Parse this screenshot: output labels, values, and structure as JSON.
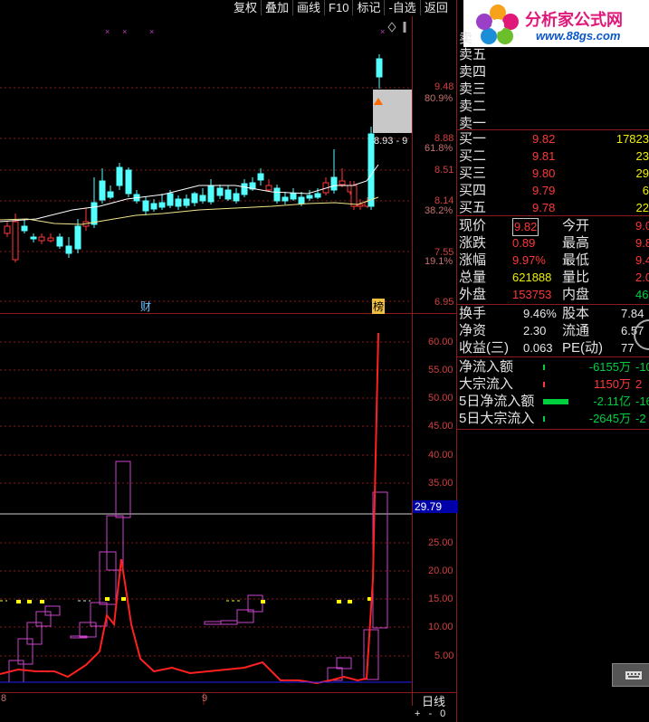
{
  "toolbar": {
    "buttons": [
      "复权",
      "叠加",
      "画线",
      "F10",
      "标记",
      "-自选",
      "返回"
    ]
  },
  "logo": {
    "title": "分析家公式网",
    "url": "www.88gs.com"
  },
  "price_axis": {
    "labels": [
      "9.48",
      "80.9%",
      "8.88",
      "61.8%",
      "8.51",
      "8.14",
      "38.2%",
      "7.55",
      "19.1%",
      "6.95"
    ],
    "selection_label": "8.93 - 9",
    "event_markers": [
      "财",
      "榜"
    ]
  },
  "indicator_axis": {
    "labels": [
      "60.00",
      "55.00",
      "50.00",
      "45.00",
      "40.00",
      "35.00",
      "30.00",
      "25.00",
      "20.00",
      "15.00",
      "10.00",
      "5.00"
    ],
    "cursor_value": "29.79"
  },
  "bottom": {
    "date_labels": [
      "8",
      "9"
    ],
    "period": "日线",
    "controls": [
      "+",
      "-",
      "0"
    ]
  },
  "quote": {
    "header_label": "卖",
    "sell": [
      {
        "label": "卖五",
        "price": "",
        "vol": ""
      },
      {
        "label": "卖四",
        "price": "",
        "vol": ""
      },
      {
        "label": "卖三",
        "price": "",
        "vol": ""
      },
      {
        "label": "卖二",
        "price": "",
        "vol": ""
      },
      {
        "label": "卖一",
        "price": "",
        "vol": ""
      }
    ],
    "buy": [
      {
        "label": "买一",
        "price": "9.82",
        "vol": "17823"
      },
      {
        "label": "买二",
        "price": "9.81",
        "vol": "23"
      },
      {
        "label": "买三",
        "price": "9.80",
        "vol": "29"
      },
      {
        "label": "买四",
        "price": "9.79",
        "vol": "6"
      },
      {
        "label": "买五",
        "price": "9.78",
        "vol": "22"
      }
    ],
    "stats_left": [
      {
        "label": "现价",
        "value": "9.82",
        "boxed": true,
        "color": "red"
      },
      {
        "label": "涨跌",
        "value": "0.89",
        "color": "red"
      },
      {
        "label": "涨幅",
        "value": "9.97%",
        "color": "red"
      },
      {
        "label": "总量",
        "value": "621888",
        "color": "yel"
      },
      {
        "label": "外盘",
        "value": "153753",
        "color": "red"
      }
    ],
    "stats_right": [
      {
        "label": "今开",
        "value": "9.0",
        "color": "red"
      },
      {
        "label": "最高",
        "value": "9.8",
        "color": "red"
      },
      {
        "label": "最低",
        "value": "9.4",
        "color": "red"
      },
      {
        "label": "量比",
        "value": "2.0",
        "color": "red"
      },
      {
        "label": "内盘",
        "value": "4681",
        "color": "grn"
      }
    ],
    "fundamentals_left": [
      {
        "label": "换手",
        "value": "9.46%"
      },
      {
        "label": "净资",
        "value": "2.30"
      },
      {
        "label": "收益(三)",
        "value": "0.063"
      }
    ],
    "fundamentals_right": [
      {
        "label": "股本",
        "value": "7.84"
      },
      {
        "label": "流通",
        "value": "6.57"
      },
      {
        "label": "PE(动)",
        "value": "77"
      }
    ],
    "flows": [
      {
        "label": "净流入额",
        "value": "-6155万",
        "extra": "-10",
        "color": "grn",
        "bar": 0.05
      },
      {
        "label": "大宗流入",
        "value": "1150万",
        "extra": "2",
        "color": "red",
        "bar": 0.01
      },
      {
        "label": "5日净流入额",
        "value": "-2.11亿",
        "extra": "-16",
        "color": "grn",
        "bar": 0.7
      },
      {
        "label": "5日大宗流入",
        "value": "-2645万",
        "extra": "-2",
        "color": "grn",
        "bar": 0.02
      }
    ]
  },
  "colors": {
    "up": "#ff3838",
    "down": "#54ffff",
    "ma1": "#ffffff",
    "ma2": "#f0e68c",
    "indicator_line": "#ff2020",
    "box": "#cc44cc",
    "marker": "#ffff00",
    "grid": "#8b1a1a"
  }
}
